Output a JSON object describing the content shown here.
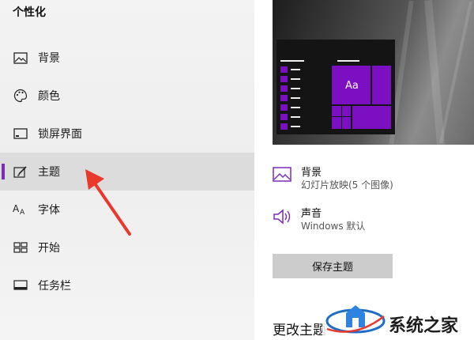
{
  "sidebar": {
    "title": "个性化",
    "items": [
      {
        "label": "背景",
        "icon": "image-icon"
      },
      {
        "label": "颜色",
        "icon": "palette-icon"
      },
      {
        "label": "锁屏界面",
        "icon": "lock-screen-icon"
      },
      {
        "label": "主题",
        "icon": "theme-brush-icon",
        "selected": true
      },
      {
        "label": "字体",
        "icon": "font-icon"
      },
      {
        "label": "开始",
        "icon": "start-grid-icon"
      },
      {
        "label": "任务栏",
        "icon": "taskbar-icon"
      }
    ]
  },
  "main": {
    "preview_tile_text": "Aa",
    "background": {
      "title": "背景",
      "subtitle": "幻灯片放映(5 个图像)",
      "icon": "image-icon"
    },
    "sound": {
      "title": "声音",
      "subtitle": "Windows 默认",
      "icon": "speaker-icon"
    },
    "save_button": "保存主题",
    "change_heading": "更改主题"
  },
  "watermark": {
    "text": "系统之家"
  },
  "colors": {
    "accent": "#7a2bb8",
    "tile": "#7b0fc1",
    "selected_bg": "#dcdcdc",
    "arrow": "#e8392c"
  }
}
